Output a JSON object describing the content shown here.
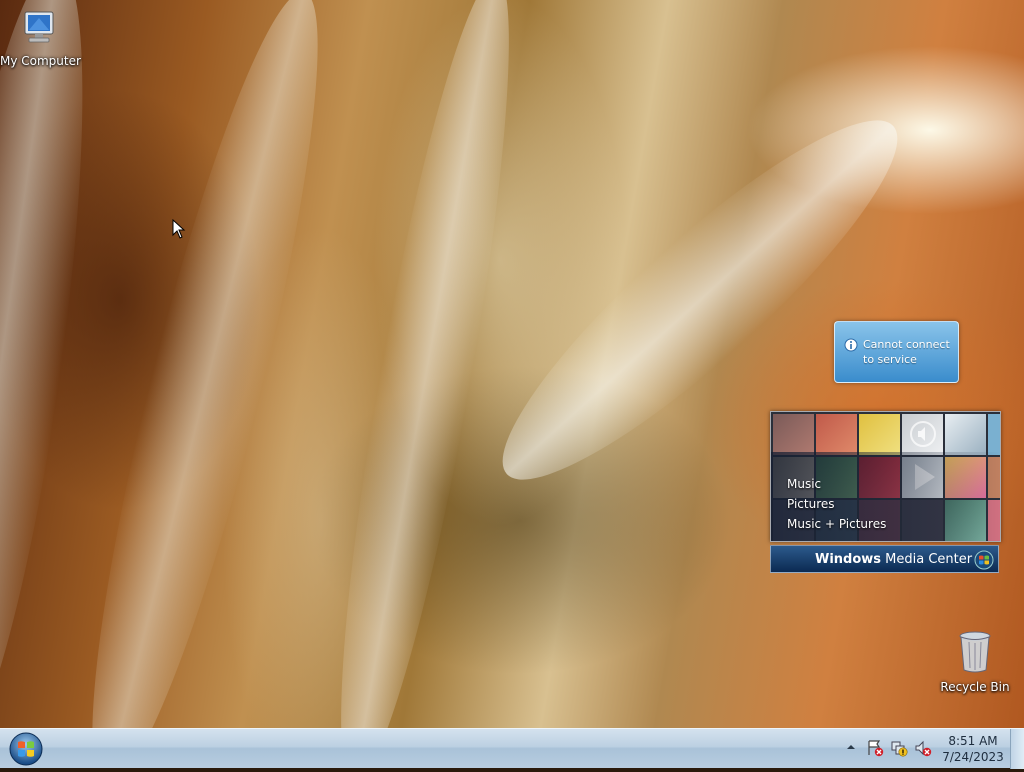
{
  "desktop": {
    "icons": [
      {
        "label": "My Computer",
        "icon": "computer-icon"
      },
      {
        "label": "Recycle Bin",
        "icon": "recycle-bin-icon"
      }
    ]
  },
  "notification": {
    "icon": "info-icon",
    "message": "Cannot connect to service"
  },
  "media_center_gadget": {
    "menu": [
      "Music",
      "Pictures",
      "Music + Pictures"
    ],
    "brand_bold": "Windows",
    "brand_regular": " Media Center"
  },
  "taskbar": {
    "start_icon": "windows-orb-icon",
    "tray_icons": [
      "show-hidden-icons",
      "action-center-icon",
      "network-icon",
      "volume-muted-icon"
    ],
    "clock": {
      "time": "8:51 AM",
      "date": "7/24/2023"
    }
  },
  "colors": {
    "taskbar": "#bcd0e2",
    "notification": "#3a8ccc",
    "media_center_bar": "#0b2a52"
  }
}
